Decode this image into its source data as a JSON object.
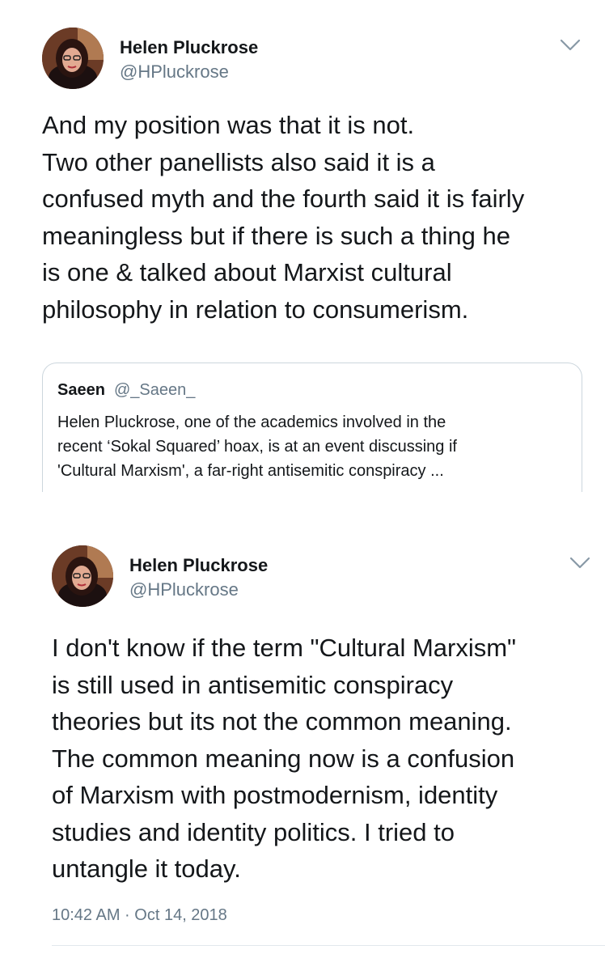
{
  "tweets": [
    {
      "author_name": "Helen Pluckrose",
      "author_handle": "@HPluckrose",
      "text": "And my position was that it is not.\nTwo other panellists also said it is a\nconfused myth and the fourth said it is fairly\nmeaningless but if there is such a thing he\nis one & talked about Marxist cultural\nphilosophy in relation to consumerism.",
      "quoted": {
        "name": "Saeen",
        "handle": "@_Saeen_",
        "text": "Helen Pluckrose, one of the academics involved in the\nrecent ‘Sokal Squared’ hoax, is at an event discussing if\n'Cultural Marxism', a far-right antisemitic conspiracy ..."
      }
    },
    {
      "author_name": "Helen Pluckrose",
      "author_handle": "@HPluckrose",
      "text": "I don't know if the term \"Cultural Marxism\"\nis still used in antisemitic conspiracy\ntheories but its not the common meaning.\nThe common meaning now is a confusion\nof Marxism with postmodernism, identity\nstudies and identity politics. I tried to\nuntangle it today.",
      "timestamp": "10:42 AM · Oct 14, 2018"
    }
  ],
  "icons": {
    "menu": "chevron-down-icon",
    "avatar": "avatar-photo"
  },
  "colors": {
    "text": "#14171a",
    "secondary": "#657786",
    "border": "#ccd6dd"
  }
}
